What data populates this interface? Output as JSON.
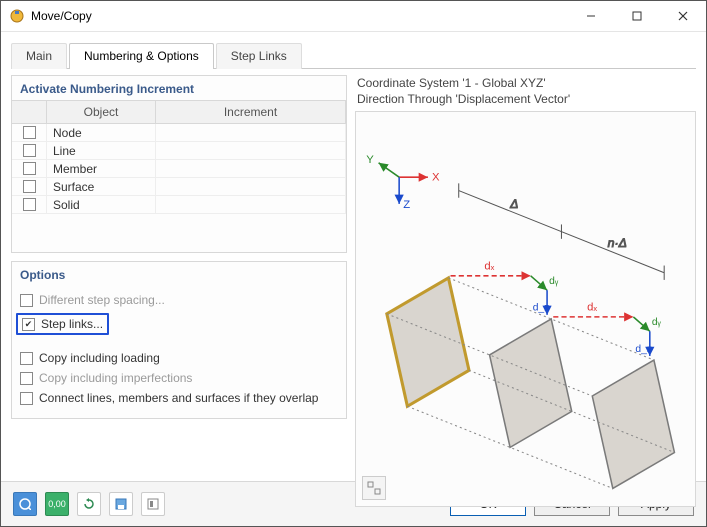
{
  "window": {
    "title": "Move/Copy"
  },
  "tabs": {
    "main": "Main",
    "numbering": "Numbering & Options",
    "steplinks": "Step Links",
    "active": "numbering"
  },
  "numbering_panel": {
    "title": "Activate Numbering Increment",
    "columns": {
      "object": "Object",
      "increment": "Increment"
    },
    "rows": [
      {
        "object": "Node",
        "checked": false,
        "increment": ""
      },
      {
        "object": "Line",
        "checked": false,
        "increment": ""
      },
      {
        "object": "Member",
        "checked": false,
        "increment": ""
      },
      {
        "object": "Surface",
        "checked": false,
        "increment": ""
      },
      {
        "object": "Solid",
        "checked": false,
        "increment": ""
      }
    ]
  },
  "options_panel": {
    "title": "Options",
    "items": {
      "diff_spacing": {
        "label": "Different step spacing...",
        "checked": false,
        "enabled": false
      },
      "step_links": {
        "label": "Step links...",
        "checked": true,
        "enabled": true,
        "highlighted": true
      },
      "copy_loading": {
        "label": "Copy including loading",
        "checked": false,
        "enabled": true
      },
      "copy_imperf": {
        "label": "Copy including imperfections",
        "checked": false,
        "enabled": false
      },
      "connect": {
        "label": "Connect lines, members and surfaces if they overlap",
        "checked": false,
        "enabled": true
      }
    }
  },
  "preview": {
    "line1": "Coordinate System '1 - Global XYZ'",
    "line2": "Direction Through 'Displacement Vector'",
    "axes": {
      "x": "X",
      "y": "Y",
      "z": "Z"
    },
    "labels": {
      "delta": "Δ",
      "ndelta": "n·Δ",
      "dx": "dₓ",
      "dy": "dᵧ",
      "dz": "d_z"
    }
  },
  "footer": {
    "ok": "OK",
    "cancel": "Cancel",
    "apply": "Apply",
    "tool_decimal": "0,00"
  }
}
